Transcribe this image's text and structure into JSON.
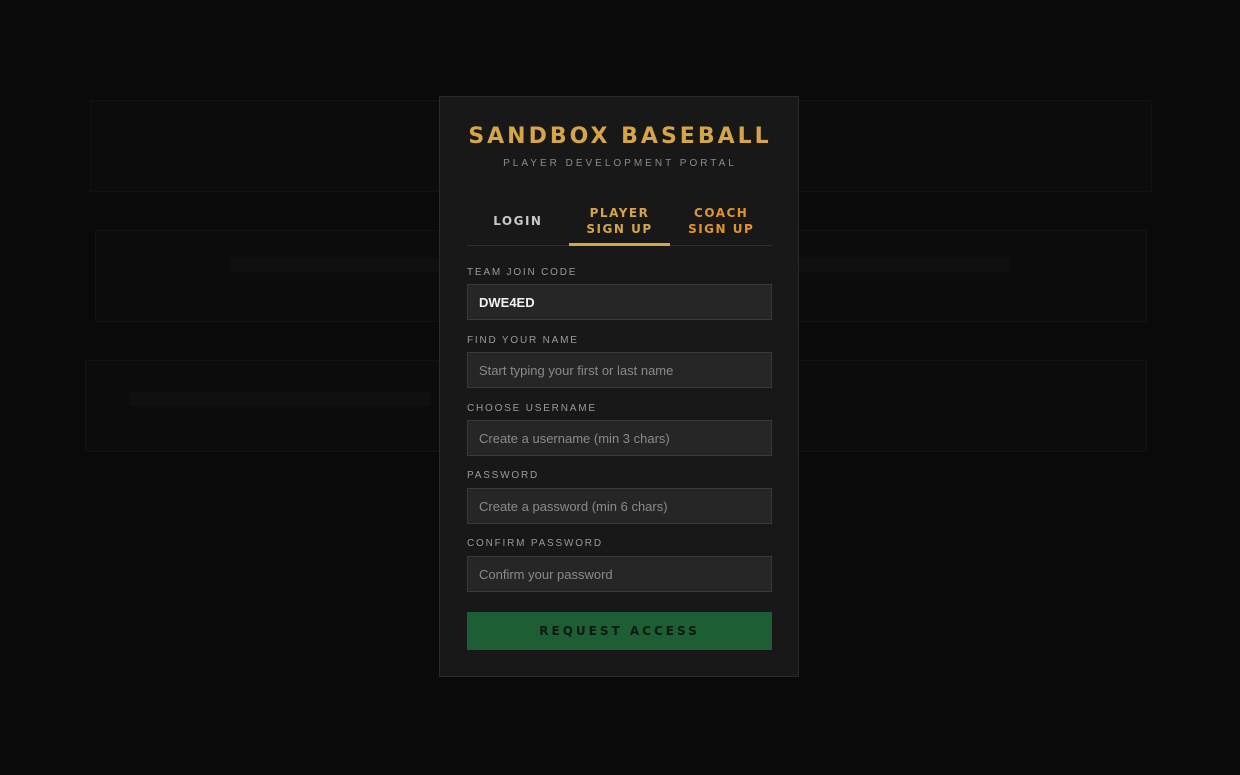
{
  "brand": {
    "title": "SANDBOX BASEBALL",
    "subtitle": "PLAYER DEVELOPMENT PORTAL"
  },
  "tabs": [
    {
      "label": "LOGIN",
      "active": false
    },
    {
      "label": "PLAYER SIGN UP",
      "active": true
    },
    {
      "label": "COACH SIGN UP",
      "active": false
    }
  ],
  "form": {
    "team_code": {
      "label": "TEAM JOIN CODE",
      "value": "DWE4ED",
      "placeholder": ""
    },
    "find_name": {
      "label": "FIND YOUR NAME",
      "value": "",
      "placeholder": "Start typing your first or last name"
    },
    "username": {
      "label": "CHOOSE USERNAME",
      "value": "",
      "placeholder": "Create a username (min 3 chars)"
    },
    "password": {
      "label": "PASSWORD",
      "value": "",
      "placeholder": "Create a password (min 6 chars)"
    },
    "confirm_password": {
      "label": "CONFIRM PASSWORD",
      "value": "",
      "placeholder": "Confirm your password"
    },
    "submit_label": "REQUEST ACCESS"
  },
  "colors": {
    "accent_gold": "#d6a54a",
    "accent_orange": "#e0952e",
    "submit_green": "#1d5e34",
    "modal_bg": "#181818",
    "backdrop": "#0a0a0a"
  }
}
